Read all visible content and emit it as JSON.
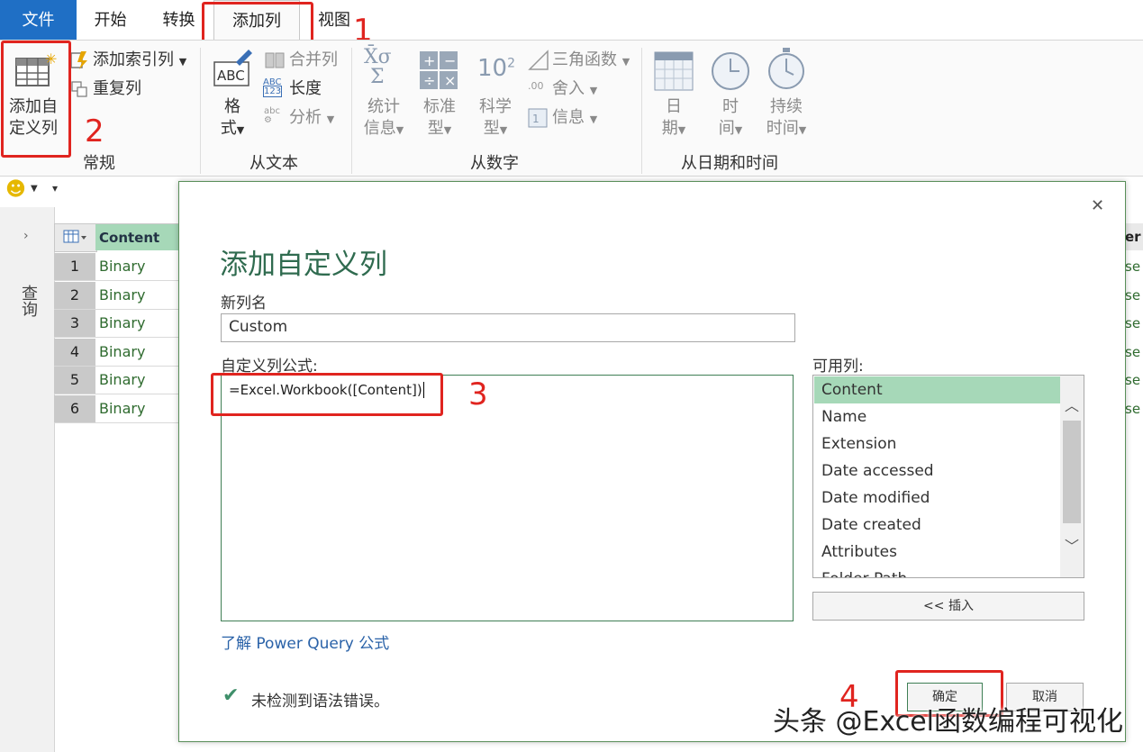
{
  "tabs": [
    "文件",
    "开始",
    "转换",
    "添加列",
    "视图"
  ],
  "ribbon": {
    "general": {
      "custom_col_line1": "添加自",
      "custom_col_line2": "定义列",
      "index_col": "添加索引列",
      "dup_col": "重复列",
      "label": "常规"
    },
    "from_text": {
      "format_line1": "格",
      "format_line2": "式",
      "merge": "合并列",
      "length": "长度",
      "analyze": "分析",
      "label": "从文本"
    },
    "from_number": {
      "stats_line1": "统计",
      "stats_line2": "信息",
      "standard_line1": "标准",
      "standard_line2": "型",
      "sci_line1": "科学",
      "sci_line2": "型",
      "trig": "三角函数",
      "round": "舍入",
      "info": "信息",
      "label": "从数字"
    },
    "from_datetime": {
      "date_line1": "日",
      "date_line2": "期",
      "time_line1": "时",
      "time_line2": "间",
      "dur_line1": "持续",
      "dur_line2": "时间",
      "label": "从日期和时间"
    }
  },
  "annotations": [
    "1",
    "2",
    "3",
    "4"
  ],
  "sidebar": {
    "queries_label": "查询"
  },
  "grid": {
    "column_header": "Content",
    "rows": [
      {
        "num": "1",
        "content": "Binary"
      },
      {
        "num": "2",
        "content": "Binary"
      },
      {
        "num": "3",
        "content": "Binary"
      },
      {
        "num": "4",
        "content": "Binary"
      },
      {
        "num": "5",
        "content": "Binary"
      },
      {
        "num": "6",
        "content": "Binary"
      }
    ],
    "right_header_fragment": "er",
    "right_cell_fragment": "se"
  },
  "dialog": {
    "title": "添加自定义列",
    "new_col_label": "新列名",
    "new_col_value": "Custom",
    "formula_label": "自定义列公式:",
    "formula_value": "=Excel.Workbook([Content])",
    "available_label": "可用列:",
    "available": [
      "Content",
      "Name",
      "Extension",
      "Date accessed",
      "Date modified",
      "Date created",
      "Attributes",
      "Folder Path"
    ],
    "insert_button": "<< 插入",
    "learn_link": "了解 Power Query 公式",
    "status": "未检测到语法错误。",
    "ok": "确定",
    "cancel": "取消"
  },
  "watermark": "头条 @Excel函数编程可视化",
  "colors": {
    "accent": "#1f6fc5",
    "selected": "#a6d8b8",
    "annotation": "#e0241f",
    "dialog_title": "#2f6b4f"
  }
}
